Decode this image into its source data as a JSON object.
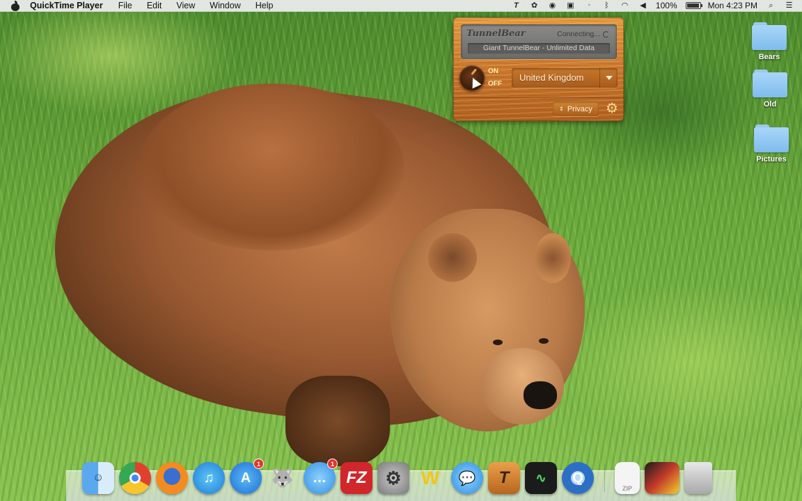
{
  "menubar": {
    "app_name": "QuickTime Player",
    "menus": [
      "File",
      "Edit",
      "View",
      "Window",
      "Help"
    ],
    "battery_percent": "100%",
    "clock": "Mon 4:23 PM"
  },
  "tunnelbear": {
    "logo": "TunnelBear",
    "status": "Connecting...",
    "plan": "Giant TunnelBear - Unlimited Data",
    "on_label": "ON",
    "off_label": "OFF",
    "country": "United Kingdom",
    "privacy_label": "Privacy"
  },
  "desktop": {
    "folders": [
      "Bears",
      "Old",
      "Pictures"
    ]
  },
  "dock": {
    "items": [
      {
        "name": "Finder",
        "icon": "finder-icon"
      },
      {
        "name": "Chrome",
        "icon": "chrome-icon"
      },
      {
        "name": "Firefox",
        "icon": "firefox-icon"
      },
      {
        "name": "iTunes",
        "icon": "itunes-icon"
      },
      {
        "name": "App Store",
        "icon": "app-store-icon",
        "badge": "1"
      },
      {
        "name": "GIMP",
        "icon": "gimp-icon"
      },
      {
        "name": "Messages",
        "icon": "messages-icon",
        "badge": "1"
      },
      {
        "name": "FileZilla",
        "icon": "filezilla-icon"
      },
      {
        "name": "System Preferences",
        "icon": "system-preferences-icon"
      },
      {
        "name": "Weka",
        "icon": "weka-icon"
      },
      {
        "name": "Speech Bubble",
        "icon": "chat-icon"
      },
      {
        "name": "TunnelBear",
        "icon": "tunnelbear-icon"
      },
      {
        "name": "Activity Monitor",
        "icon": "activity-monitor-icon"
      },
      {
        "name": "QuickTime Player",
        "icon": "quicktime-icon"
      }
    ],
    "stack_items": [
      {
        "name": "Archive",
        "icon": "zip-file-icon",
        "label": "ZIP"
      },
      {
        "name": "Screenshots",
        "icon": "screenshots-stack-icon"
      },
      {
        "name": "Trash",
        "icon": "trash-icon"
      }
    ]
  }
}
